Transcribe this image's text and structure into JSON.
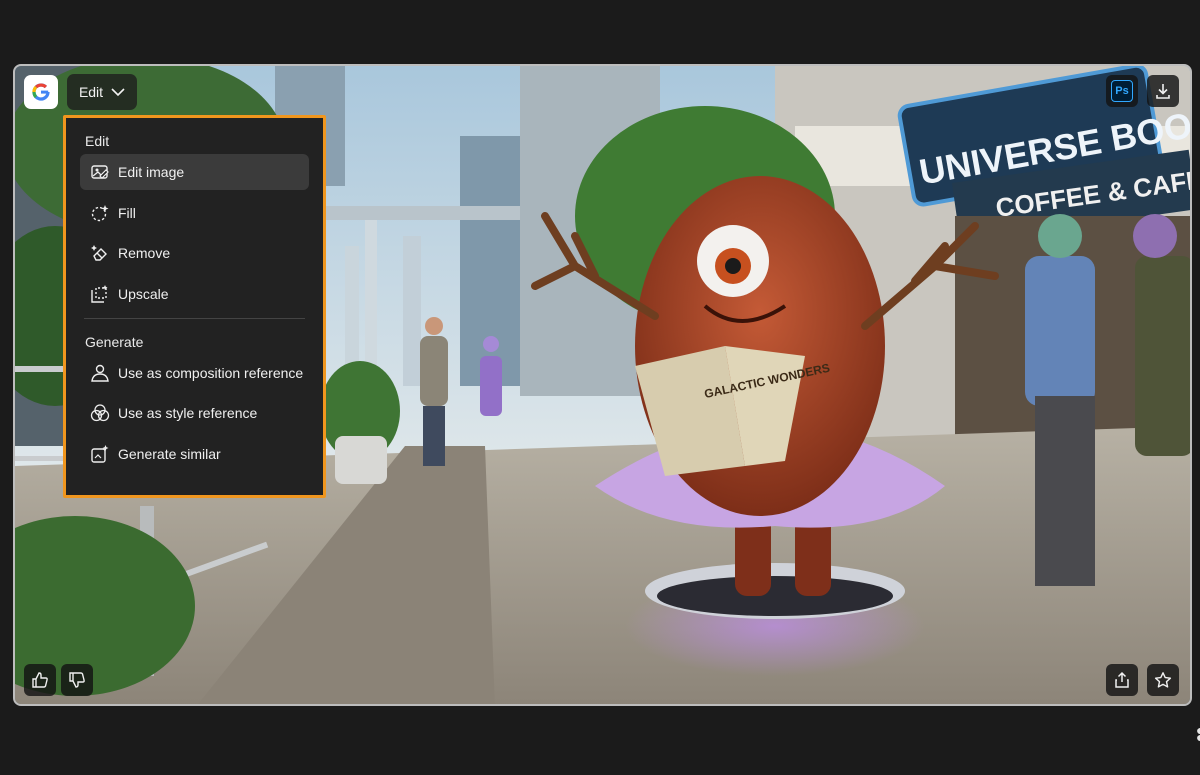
{
  "toolbar": {
    "google_icon": "google-logo-icon",
    "edit_label": "Edit",
    "photoshop_label": "Ps",
    "download_icon": "download-icon",
    "share_icon": "share-icon",
    "favorite_icon": "star-icon",
    "like_icon": "thumbs-up-icon",
    "dislike_icon": "thumbs-down-icon"
  },
  "menu": {
    "sections": [
      {
        "heading": "Edit",
        "items": [
          {
            "label": "Edit image",
            "icon": "edit-image-icon",
            "active": true
          },
          {
            "label": "Fill",
            "icon": "fill-icon"
          },
          {
            "label": "Remove",
            "icon": "remove-icon"
          },
          {
            "label": "Upscale",
            "icon": "upscale-icon"
          }
        ]
      },
      {
        "heading": "Generate",
        "items": [
          {
            "label": "Use as composition reference",
            "icon": "composition-reference-icon"
          },
          {
            "label": "Use as style reference",
            "icon": "style-reference-icon"
          },
          {
            "label": "Generate similar",
            "icon": "generate-similar-icon"
          }
        ]
      }
    ]
  },
  "image": {
    "sign_top": "UNIVERSE BOOK",
    "sign_bottom": "COFFEE & CAFE",
    "book_title": "GALACTIC WONDERS",
    "book_spine": "GALACTIC WONDERS"
  },
  "colors": {
    "highlight": "#f0961e",
    "menu_bg": "#222222",
    "active_item": "#3b3b3b"
  }
}
